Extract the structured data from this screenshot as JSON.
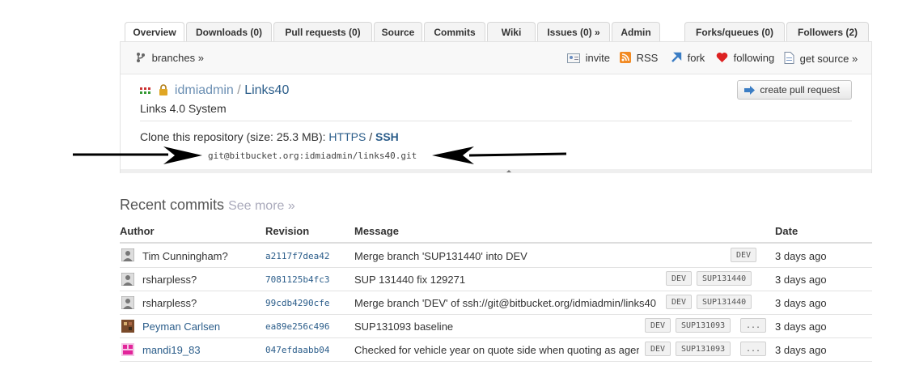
{
  "tabs": [
    {
      "label": "Overview",
      "active": true
    },
    {
      "label": "Downloads (0)"
    },
    {
      "label": "Pull requests (0)"
    },
    {
      "label": "Source"
    },
    {
      "label": "Commits"
    },
    {
      "label": "Wiki"
    },
    {
      "label": "Issues (0) »"
    },
    {
      "label": "Admin"
    },
    {
      "label": "Forks/queues (0)"
    },
    {
      "label": "Followers (2)"
    }
  ],
  "subbar": {
    "branches": "branches »",
    "invite": "invite",
    "rss": "RSS",
    "fork": "fork",
    "following": "following",
    "get_source": "get source »"
  },
  "repo": {
    "owner": "idmiadmin",
    "separator": "/",
    "name": "Links40",
    "description": "Links 4.0 System",
    "create_pr": "create pull request",
    "clone_text": "Clone this repository (size: 25.3 MB):",
    "https": "HTTPS",
    "slash": "/",
    "ssh": "SSH",
    "clone_url": "git@bitbucket.org:idmiadmin/links40.git"
  },
  "recent": {
    "title": "Recent commits",
    "see_more": "See more »"
  },
  "table": {
    "headers": {
      "author": "Author",
      "revision": "Revision",
      "message": "Message",
      "date": "Date"
    },
    "rows": [
      {
        "author": "Tim Cunningham?",
        "revision": "a2117f7dea42",
        "message": "Merge branch 'SUP131440' into DEV",
        "date": "3 days ago",
        "tags": [
          "DEV"
        ]
      },
      {
        "author": "rsharpless?",
        "revision": "7081125b4fc3",
        "message": "SUP 131440 fix 129271",
        "date": "3 days ago",
        "tags": [
          "DEV",
          "SUP131440"
        ]
      },
      {
        "author": "rsharpless?",
        "revision": "99cdb4290cfe",
        "message": "Merge branch 'DEV' of ssh://git@bitbucket.org/idmiadmin/links40",
        "date": "3 days ago",
        "tags": [
          "DEV",
          "SUP131440"
        ]
      },
      {
        "author": "Peyman Carlsen",
        "revision": "ea89e256c496",
        "message": "SUP131093 baseline",
        "date": "3 days ago",
        "tags": [
          "DEV",
          "SUP131093",
          "..."
        ]
      },
      {
        "author": "mandi19_83",
        "revision": "047efdaabb04",
        "message": "Checked for vehicle year on quote side when quoting as agent",
        "date": "3 days ago",
        "tags": [
          "DEV",
          "SUP131093",
          "..."
        ]
      }
    ]
  },
  "colors": {
    "link": "#2b5d8a",
    "accent": "#6b8fb3"
  }
}
